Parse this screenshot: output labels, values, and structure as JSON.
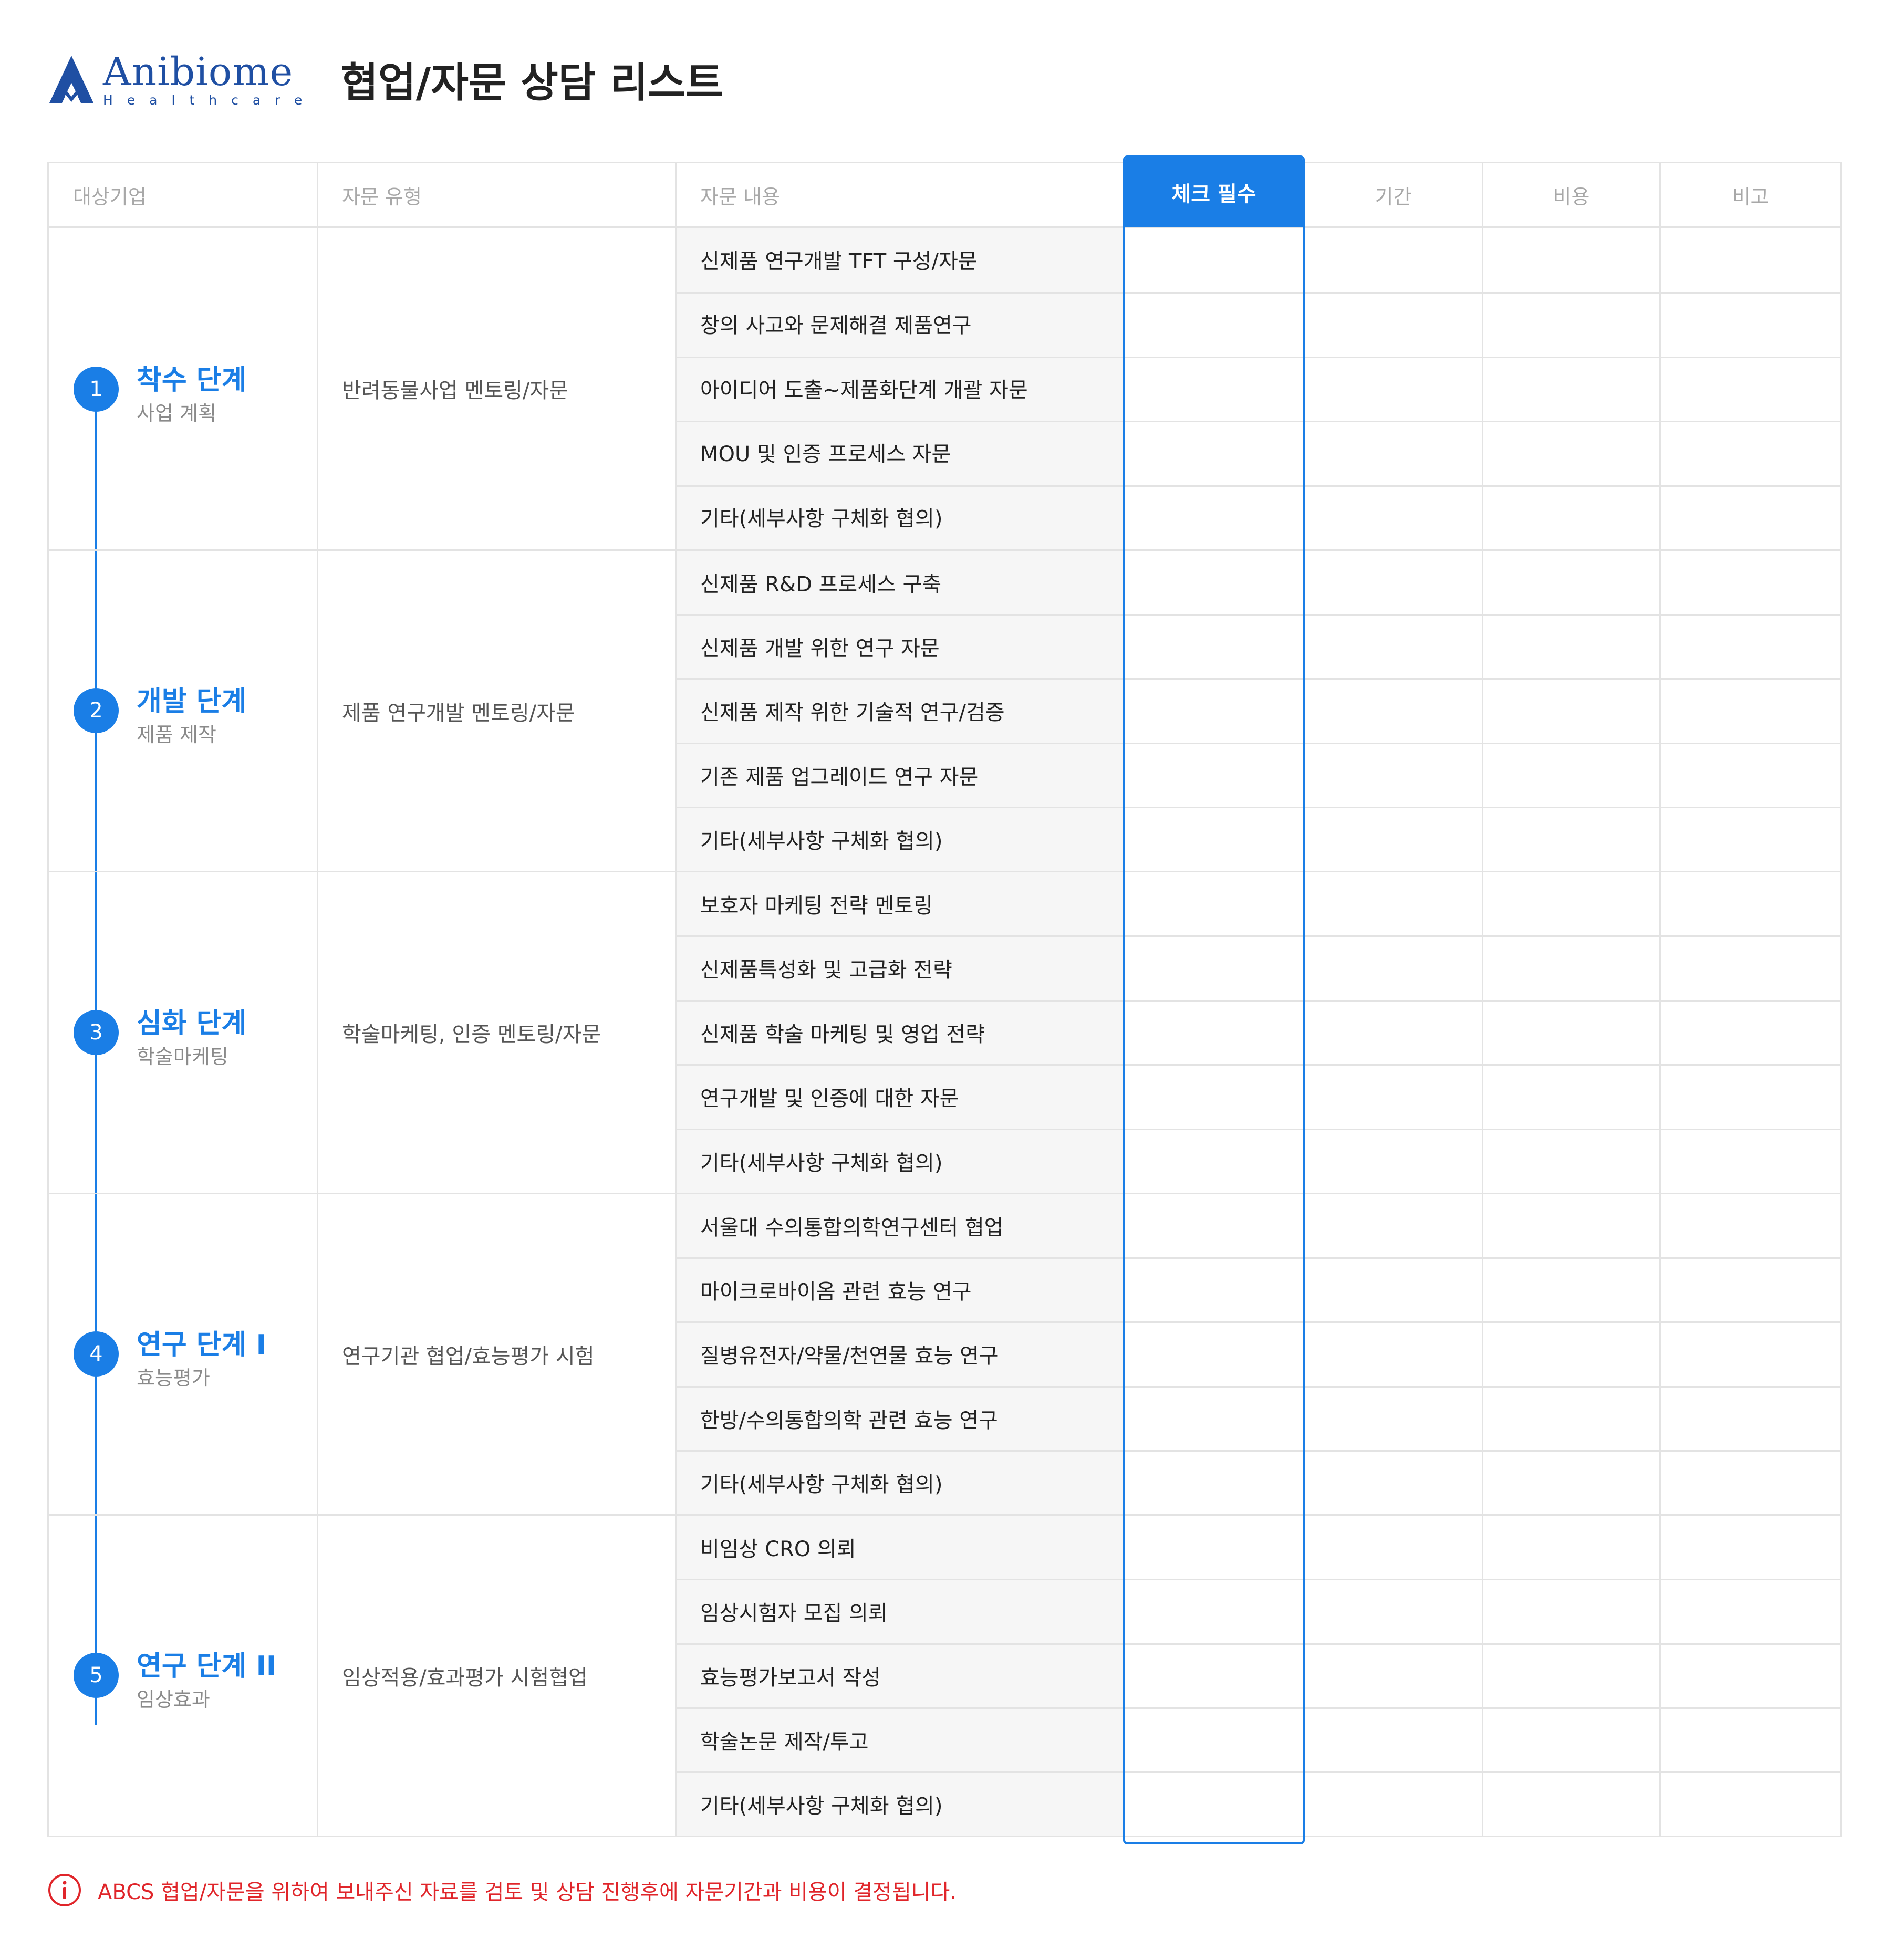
{
  "brand": {
    "name": "Anibiome",
    "sub": "Healthcare",
    "color": "#1f4fa3"
  },
  "title": "협업/자문 상담 리스트",
  "colors": {
    "accent": "#1a7ee6",
    "warning": "#e0252a",
    "border": "#e3e3e3"
  },
  "headers": {
    "company": "대상기업",
    "type": "자문 유형",
    "content": "자문 내용",
    "check": "체크 필수",
    "period": "기간",
    "cost": "비용",
    "note": "비고"
  },
  "stages": [
    {
      "num": "1",
      "title": "착수 단계",
      "sub": "사업 계획",
      "type": "반려동물사업 멘토링/자문",
      "items": [
        "신제품 연구개발 TFT 구성/자문",
        "창의 사고와 문제해결 제품연구",
        "아이디어 도출~제품화단계 개괄 자문",
        "MOU 및 인증 프로세스 자문",
        "기타(세부사항 구체화 협의)"
      ]
    },
    {
      "num": "2",
      "title": "개발 단계",
      "sub": "제품 제작",
      "type": "제품 연구개발 멘토링/자문",
      "items": [
        "신제품 R&D 프로세스 구축",
        "신제품 개발 위한 연구 자문",
        "신제품 제작 위한 기술적 연구/검증",
        "기존 제품 업그레이드 연구 자문",
        "기타(세부사항 구체화 협의)"
      ]
    },
    {
      "num": "3",
      "title": "심화 단계",
      "sub": "학술마케팅",
      "type": "학술마케팅, 인증 멘토링/자문",
      "items": [
        "보호자 마케팅 전략 멘토링",
        "신제품특성화 및 고급화 전략",
        "신제품 학술 마케팅 및 영업 전략",
        "연구개발 및 인증에 대한 자문",
        "기타(세부사항 구체화 협의)"
      ]
    },
    {
      "num": "4",
      "title": "연구 단계 I",
      "sub": "효능평가",
      "type": "연구기관 협업/효능평가 시험",
      "items": [
        "서울대 수의통합의학연구센터 협업",
        "마이크로바이옴 관련 효능 연구",
        "질병유전자/약물/천연물 효능 연구",
        "한방/수의통합의학 관련 효능 연구",
        "기타(세부사항 구체화 협의)"
      ]
    },
    {
      "num": "5",
      "title": "연구 단계 II",
      "sub": "임상효과",
      "type": "임상적용/효과평가 시험협업",
      "items": [
        "비임상 CRO 의뢰",
        "임상시험자 모집 의뢰",
        "효능평가보고서 작성",
        "학술논문 제작/투고",
        "기타(세부사항 구체화 협의)"
      ]
    }
  ],
  "notice": {
    "icon": "info-icon",
    "text": "ABCS 협업/자문을 위하여 보내주신 자료를 검토 및 상담 진행후에 자문기간과 비용이 결정됩니다."
  }
}
